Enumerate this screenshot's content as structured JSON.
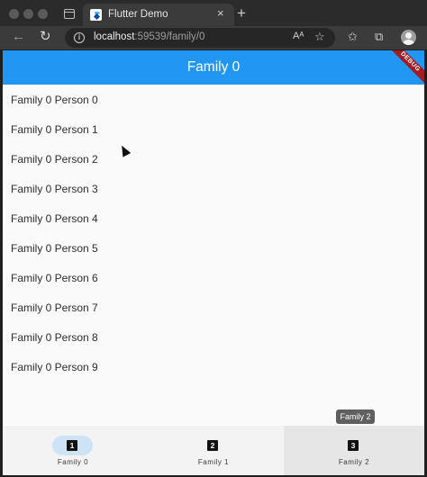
{
  "browser": {
    "tab_title": "Flutter Demo",
    "tab_close": "×",
    "new_tab": "+",
    "url_host": "localhost",
    "url_rest": ":59539/family/0",
    "back": "←",
    "reload": "↻",
    "read_aloud": "Aᴬ",
    "favorite": "☆",
    "favorites_bar": "✩",
    "collections": "⧉"
  },
  "app": {
    "title": "Family 0",
    "debug_banner": "DEBUG",
    "people": [
      "Family 0 Person 0",
      "Family 0 Person 1",
      "Family 0 Person 2",
      "Family 0 Person 3",
      "Family 0 Person 4",
      "Family 0 Person 5",
      "Family 0 Person 6",
      "Family 0 Person 7",
      "Family 0 Person 8",
      "Family 0 Person 9"
    ],
    "tooltip": "Family 2",
    "bottom_nav": [
      {
        "icon": "1",
        "label": "Family 0",
        "selected": true
      },
      {
        "icon": "2",
        "label": "Family 1",
        "selected": false
      },
      {
        "icon": "3",
        "label": "Family 2",
        "selected": false
      }
    ],
    "colors": {
      "appbar": "#2196f3",
      "selected_pill": "#cfe3f7",
      "debug": "#a31c24"
    }
  }
}
